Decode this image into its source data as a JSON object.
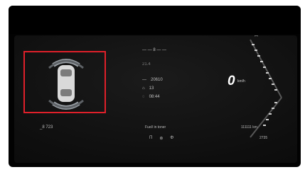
{
  "panel": {
    "top_gear_text": "ꟷ",
    "parking_sensor_range": "_8 723",
    "trip_header": "— — 8 — —",
    "trip_label": "21.4",
    "odometer": "20610",
    "avg_consumption": "13",
    "time_value": "08:44",
    "speed_value": "0",
    "speed_unit": "km/h",
    "bottom_mid_text": "Fuel/ in toner",
    "bottom_right_text": "111111 km",
    "range_value": "2735",
    "bottom_icons": [
      "Π",
      "⊛",
      "Φ"
    ]
  },
  "colors": {
    "highlight": "#e0202a",
    "gauge": "#c9c9c9"
  },
  "icons": {
    "car": "car-top-view-icon",
    "sensors": "parking-sensor-arcs-icon"
  }
}
